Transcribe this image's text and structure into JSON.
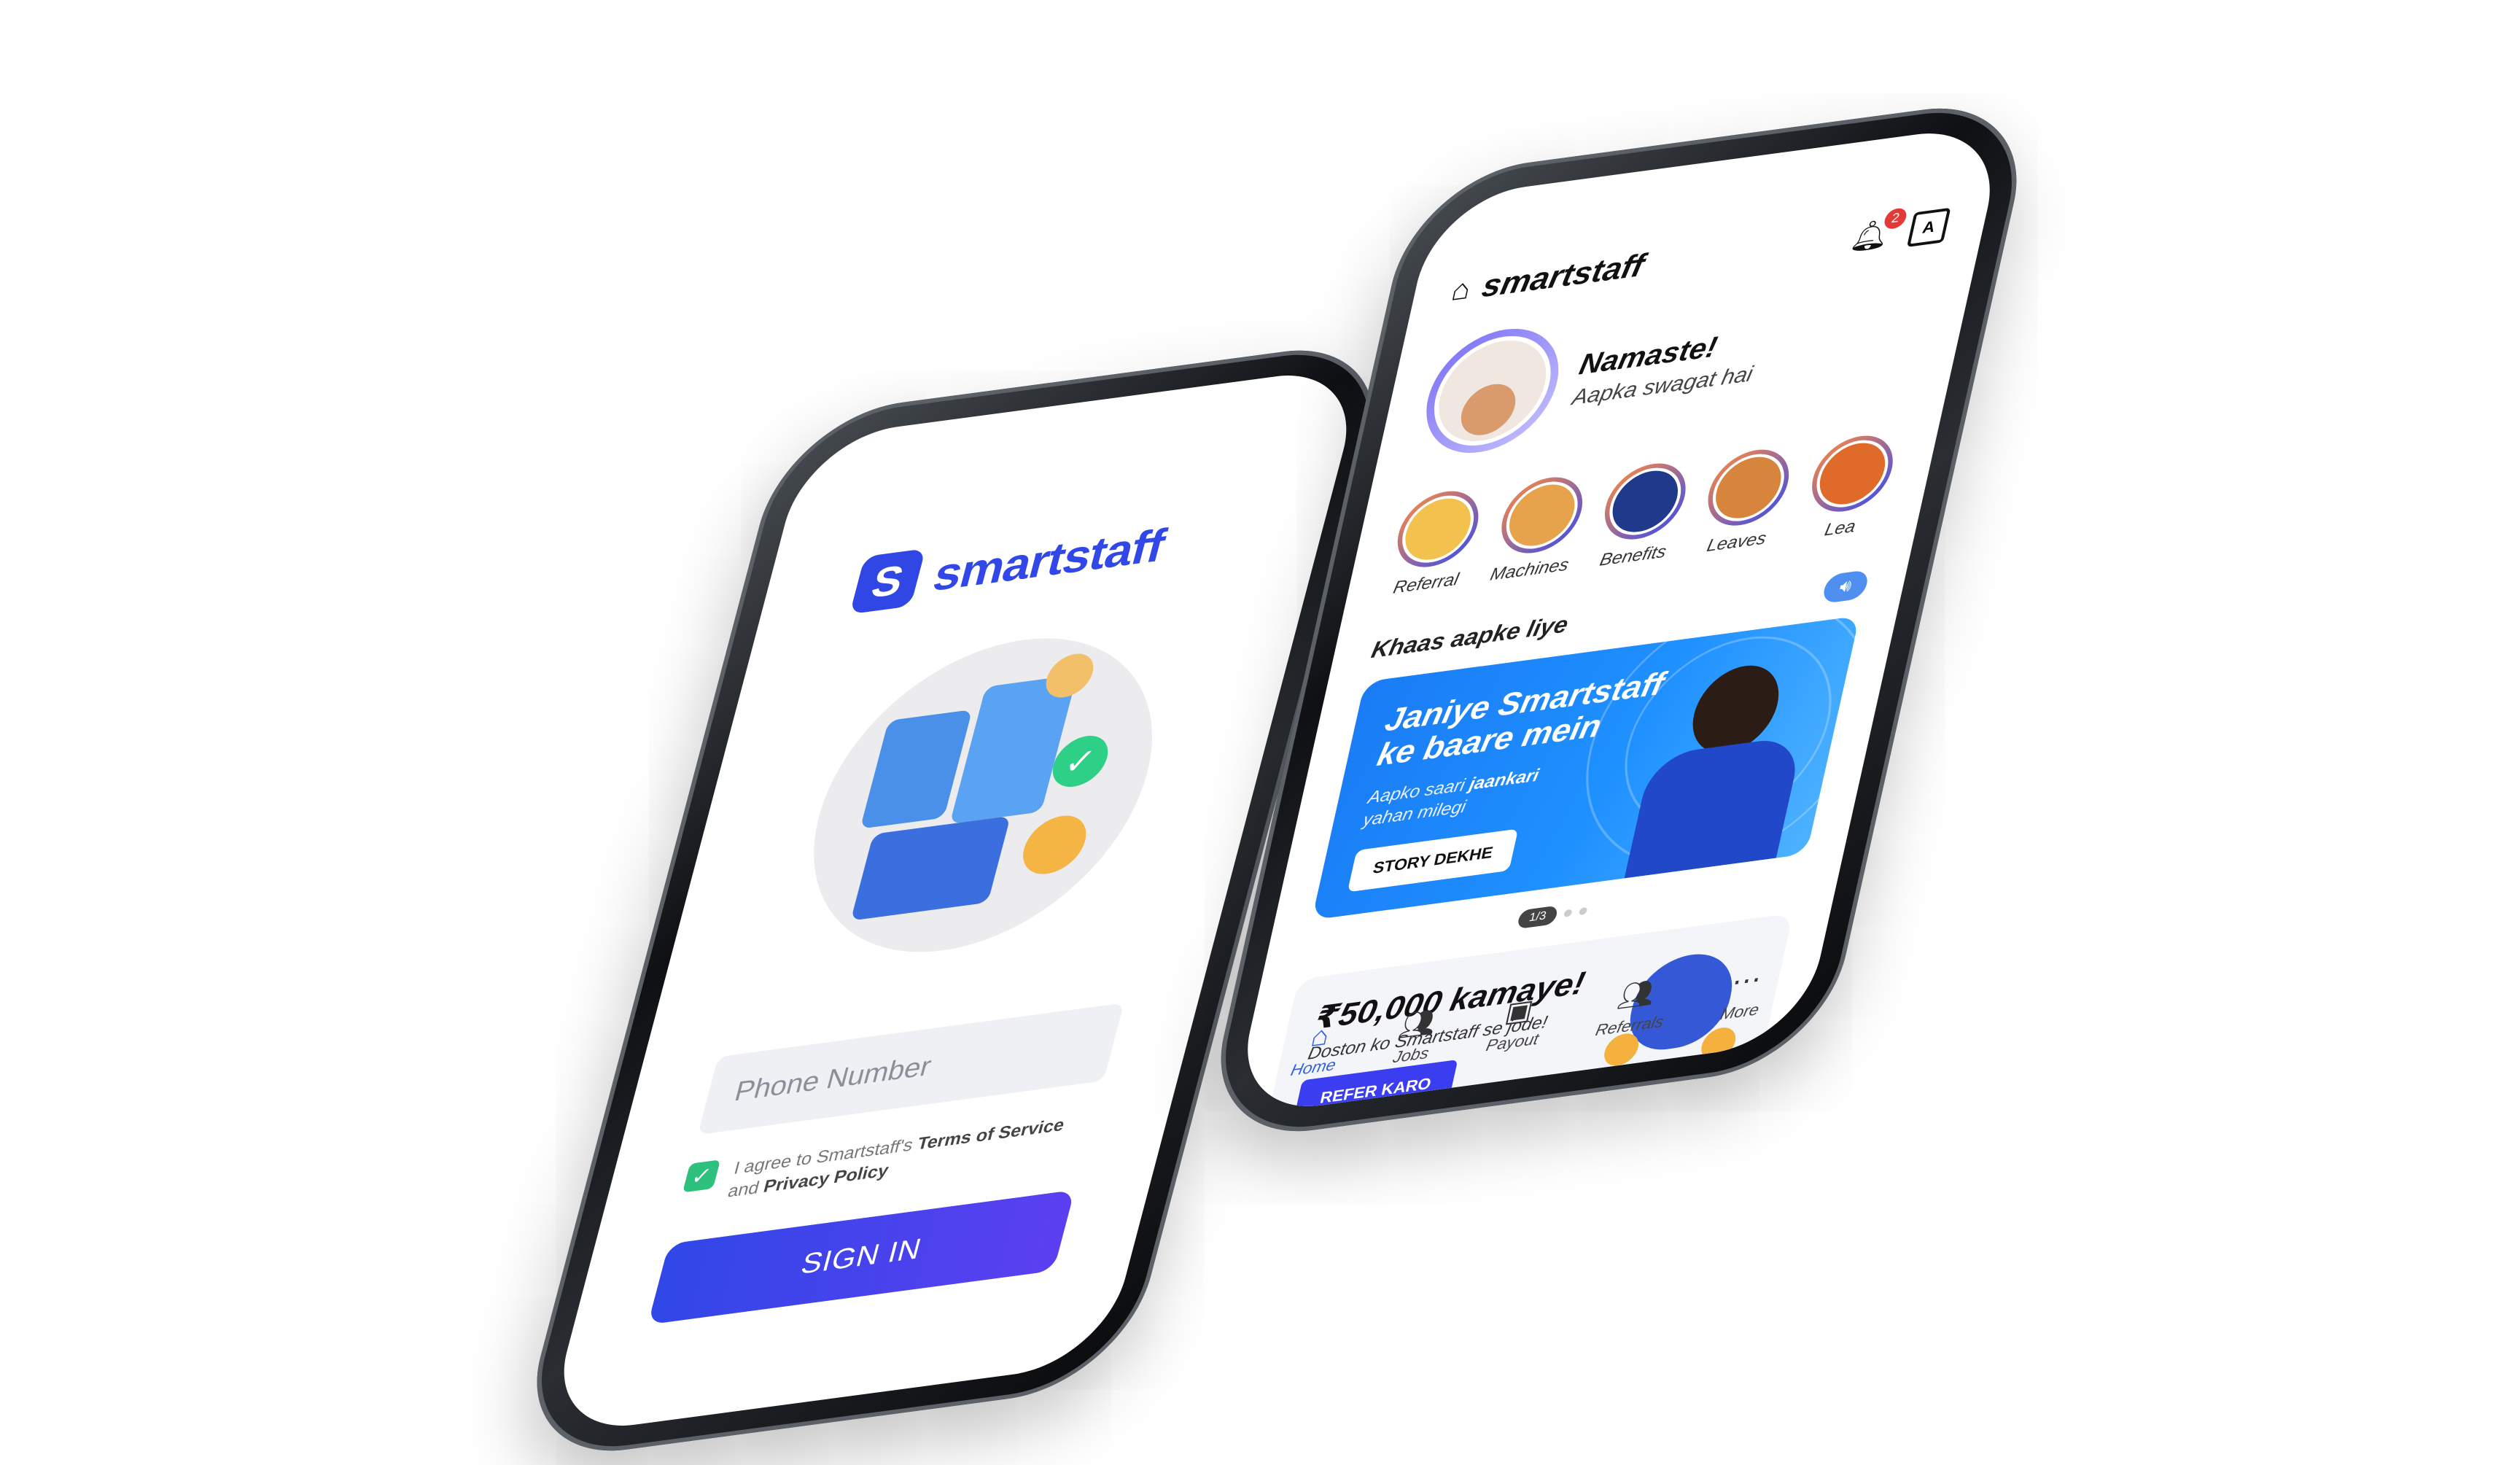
{
  "login": {
    "logo_mark": "S",
    "brand": "smartstaff",
    "phone_placeholder": "Phone Number",
    "agree_prefix": "I agree to Smartstaff's",
    "terms": "Terms of Service",
    "agree_and": "and",
    "privacy": "Privacy Policy",
    "signin_label": "SIGN IN"
  },
  "home": {
    "brand": "smartstaff",
    "notification_count": "2",
    "lang_icon": "A",
    "greeting_title": "Namaste!",
    "greeting_sub": "Aapka swagat hai",
    "quick_items": [
      {
        "label": "Referral",
        "color": "#f2c14e"
      },
      {
        "label": "Machines",
        "color": "#e7a34b"
      },
      {
        "label": "Benefits",
        "color": "#1f3a8a"
      },
      {
        "label": "Leaves",
        "color": "#d7853c"
      },
      {
        "label": "Lea",
        "color": "#e06a2a"
      }
    ],
    "section_title": "Khaas aapke liye",
    "banner": {
      "title": "Janiye Smartstaff ke baare mein",
      "sub_prefix": "Aapko saari",
      "sub_bold": "jaankari",
      "sub_suffix": "yahan milegi",
      "button": "STORY DEKHE"
    },
    "pager": "1/3",
    "refer": {
      "title": "₹50,000 kamaye!",
      "sub": "Doston ko Smartstaff se jode!",
      "button": "REFER KARO"
    },
    "nav": [
      {
        "label": "Home",
        "icon": "home-icon",
        "active": true
      },
      {
        "label": "Jobs",
        "icon": "jobs-icon",
        "active": false
      },
      {
        "label": "Payout",
        "icon": "payout-icon",
        "active": false
      },
      {
        "label": "Referrals",
        "icon": "referrals-icon",
        "active": false
      },
      {
        "label": "More",
        "icon": "more-icon",
        "active": false
      }
    ],
    "accent": "#3147e8"
  }
}
